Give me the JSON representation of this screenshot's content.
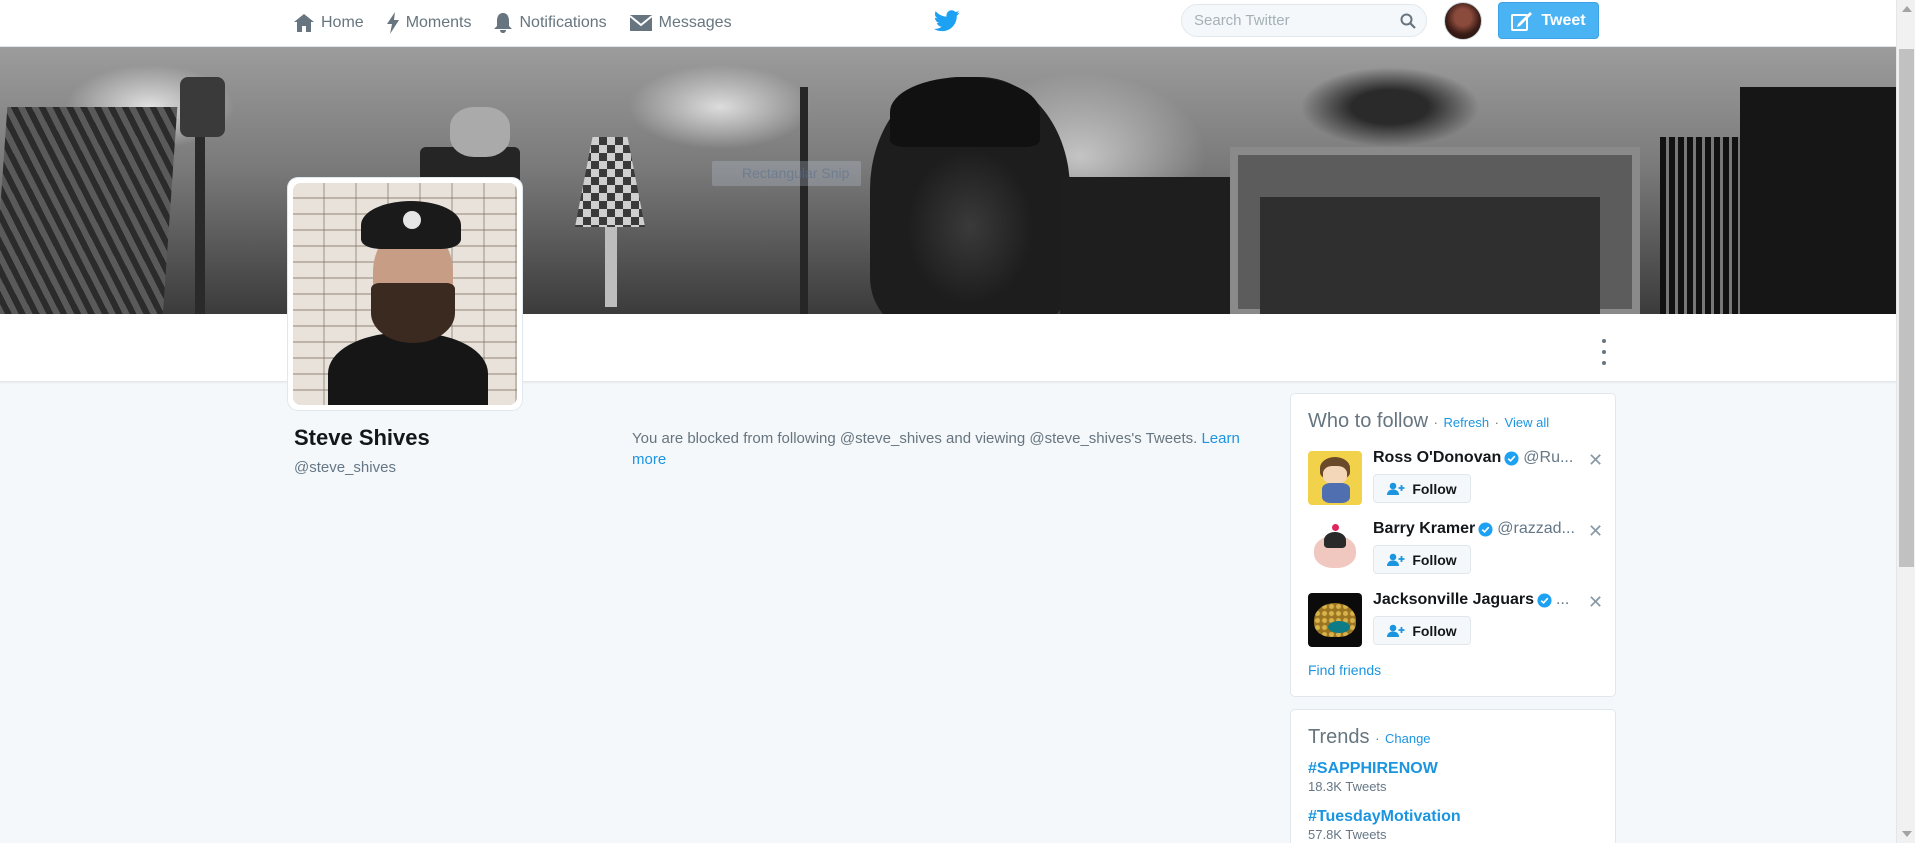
{
  "nav": {
    "home": "Home",
    "moments": "Moments",
    "notifications": "Notifications",
    "messages": "Messages"
  },
  "search": {
    "placeholder": "Search Twitter"
  },
  "tweet_button": "Tweet",
  "overlay": {
    "snip_label": "Rectangular Snip"
  },
  "profile": {
    "name": "Steve Shives",
    "handle": "@steve_shives",
    "blocked_text": "You are blocked from following @steve_shives and viewing @steve_shives's Tweets.",
    "learn_more": "Learn more"
  },
  "who_to_follow": {
    "title": "Who to follow",
    "separator": "·",
    "refresh": "Refresh",
    "view_all": "View all",
    "follow_label": "Follow",
    "users": [
      {
        "name": "Ross O'Donovan",
        "handle": "@Ru..."
      },
      {
        "name": "Barry Kramer",
        "handle": "@razzad..."
      },
      {
        "name": "Jacksonville Jaguars",
        "handle": "..."
      }
    ],
    "find_friends": "Find friends"
  },
  "trends": {
    "title": "Trends",
    "separator": "·",
    "change": "Change",
    "items": [
      {
        "tag": "#SAPPHIRENOW",
        "count": "18.3K Tweets"
      },
      {
        "tag": "#TuesdayMotivation",
        "count": "57.8K Tweets"
      }
    ]
  },
  "colors": {
    "accent": "#1b95e0",
    "tweet_button": "#4ab3f4",
    "page_bg": "#f5f8fa",
    "muted": "#66757f"
  }
}
